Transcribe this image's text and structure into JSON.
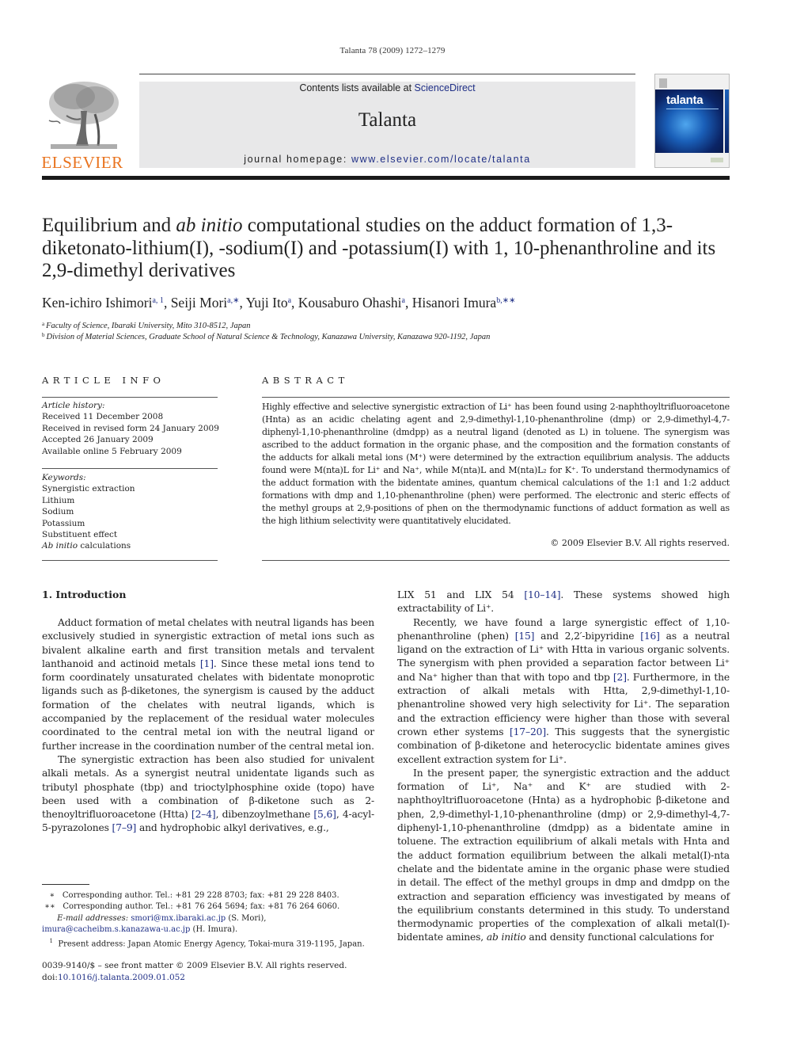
{
  "citation": "Talanta 78 (2009) 1272–1279",
  "masthead": {
    "contents_prefix": "Contents lists available at ",
    "contents_link": "ScienceDirect",
    "journal_title": "Talanta",
    "homepage_prefix": "journal homepage: ",
    "homepage_link": "www.elsevier.com/locate/talanta",
    "publisher_logo_text": "ELSEVIER",
    "cover_title": "talanta",
    "colors": {
      "publisher_orange": "#e9731e",
      "link_blue": "#1f2f86",
      "masthead_gray": "#e8e8e9"
    }
  },
  "article": {
    "title_part1": "Equilibrium and ",
    "title_italic": "ab initio",
    "title_part2": " computational studies on the adduct formation of 1,3-diketonato-lithium(I), -sodium(I) and -potassium(I) with 1, 10-phenanthroline and its 2,9-dimethyl derivatives",
    "authors": [
      {
        "name": "Ken-ichiro Ishimori",
        "marks": "a, 1"
      },
      {
        "name": "Seiji Mori",
        "marks": "a,∗"
      },
      {
        "name": "Yuji Ito",
        "marks": "a"
      },
      {
        "name": "Kousaburo Ohashi",
        "marks": "a"
      },
      {
        "name": "Hisanori Imura",
        "marks": "b,∗∗"
      }
    ],
    "affiliations": [
      {
        "mark": "a",
        "text": "Faculty of Science, Ibaraki University, Mito 310-8512, Japan"
      },
      {
        "mark": "b",
        "text": "Division of Material Sciences, Graduate School of Natural Science & Technology, Kanazawa University, Kanazawa 920-1192, Japan"
      }
    ]
  },
  "article_info": {
    "label": "ARTICLE INFO",
    "history_head": "Article history:",
    "history": [
      "Received 11 December 2008",
      "Received in revised form 24 January 2009",
      "Accepted 26 January 2009",
      "Available online 5 February 2009"
    ],
    "keywords_head": "Keywords:",
    "keywords": [
      "Synergistic extraction",
      "Lithium",
      "Sodium",
      "Potassium",
      "Substituent effect"
    ],
    "keyword_last_italic": "Ab initio",
    "keyword_last_rest": " calculations"
  },
  "abstract": {
    "label": "ABSTRACT",
    "text": "Highly effective and selective synergistic extraction of Li⁺ has been found using 2-naphthoyltrifluoroacetone (Hnta) as an acidic chelating agent and 2,9-dimethyl-1,10-phenanthroline (dmp) or 2,9-dimethyl-4,7-diphenyl-1,10-phenanthroline (dmdpp) as a neutral ligand (denoted as L) in toluene. The synergism was ascribed to the adduct formation in the organic phase, and the composition and the formation constants of the adducts for alkali metal ions (M⁺) were determined by the extraction equilibrium analysis. The adducts found were M(nta)L for Li⁺ and Na⁺, while M(nta)L and M(nta)L₂ for K⁺. To understand thermodynamics of the adduct formation with the bidentate amines, quantum chemical calculations of the 1:1 and 1:2 adduct formations with dmp and 1,10-phenanthroline (phen) were performed. The electronic and steric effects of the methyl groups at 2,9-positions of phen on the thermodynamic functions of adduct formation as well as the high lithium selectivity were quantitatively elucidated.",
    "copyright": "© 2009 Elsevier B.V. All rights reserved."
  },
  "introduction": {
    "heading": "1.  Introduction",
    "left_p1": [
      {
        "t": "Adduct formation of metal chelates with neutral ligands has been exclusively studied in synergistic extraction of metal ions such as bivalent alkaline earth and first transition metals and tervalent lanthanoid and actinoid metals "
      },
      {
        "ref": "[1]"
      },
      {
        "t": ". Since these metal ions tend to form coordinately unsaturated chelates with bidentate monoprotic ligands such as β-diketones, the synergism is caused by the adduct formation of the chelates with neutral ligands, which is accompanied by the replacement of the residual water molecules coordinated to the central metal ion with the neutral ligand or further increase in the coordination number of the central metal ion."
      }
    ],
    "left_p2": [
      {
        "t": "The synergistic extraction has been also studied for univalent alkali metals. As a synergist neutral unidentate ligands such as tributyl phosphate (tbp) and trioctylphosphine oxide (topo) have been used with a combination of β-diketone such as 2-thenoyltrifluoroacetone (Htta) "
      },
      {
        "ref": "[2–4]"
      },
      {
        "t": ", dibenzoylmethane "
      },
      {
        "ref": "[5,6]"
      },
      {
        "t": ", 4-acyl-5-pyrazolones "
      },
      {
        "ref": "[7–9]"
      },
      {
        "t": " and hydrophobic alkyl derivatives, e.g.,"
      }
    ],
    "right_p0": [
      {
        "t": "LIX 51 and LIX 54 "
      },
      {
        "ref": "[10–14]"
      },
      {
        "t": ". These systems showed high extractability of Li⁺."
      }
    ],
    "right_p1": [
      {
        "t": "Recently, we have found a large synergistic effect of 1,10-phenanthroline (phen) "
      },
      {
        "ref": "[15]"
      },
      {
        "t": " and 2,2′-bipyridine "
      },
      {
        "ref": "[16]"
      },
      {
        "t": " as a neutral ligand on the extraction of Li⁺ with Htta in various organic solvents. The synergism with phen provided a separation factor between Li⁺ and Na⁺ higher than that with topo and tbp "
      },
      {
        "ref": "[2]"
      },
      {
        "t": ". Furthermore, in the extraction of alkali metals with Htta, 2,9-dimethyl-1,10-phenantroline showed very high selectivity for Li⁺. The separation and the extraction efficiency were higher than those with several crown ether systems "
      },
      {
        "ref": "[17–20]"
      },
      {
        "t": ". This suggests that the synergistic combination of β-diketone and heterocyclic bidentate amines gives excellent extraction system for Li⁺."
      }
    ],
    "right_p2": [
      {
        "t": "In the present paper, the synergistic extraction and the adduct formation of Li⁺, Na⁺ and K⁺ are studied with 2-naphthoyltrifluoroacetone (Hnta) as a hydrophobic β-diketone and phen, 2,9-dimethyl-1,10-phenanthroline (dmp) or 2,9-dimethyl-4,7-diphenyl-1,10-phenanthroline (dmdpp) as a bidentate amine in toluene. The extraction equilibrium of alkali metals with Hnta and the adduct formation equilibrium between the alkali metal(I)-nta chelate and the bidentate amine in the organic phase were studied in detail. The effect of the methyl groups in dmp and dmdpp on the extraction and separation efficiency was investigated by means of the equilibrium constants determined in this study. To understand thermodynamic properties of the complexation of alkali metal(I)-bidentate amines, "
      },
      {
        "i": "ab initio"
      },
      {
        "t": " and density functional calculations for"
      }
    ]
  },
  "footnotes": {
    "fn1_mark": "∗",
    "fn1_text": "Corresponding author. Tel.: +81 29 228 8703; fax: +81 29 228 8403.",
    "fn2_mark": "∗∗",
    "fn2_text": "Corresponding author. Tel.: +81 76 264 5694; fax: +81 76 264 6060.",
    "email_label": "E-mail addresses:",
    "email1": "smori@mx.ibaraki.ac.jp",
    "email1_owner": " (S. Mori),",
    "email2": "imura@cacheibm.s.kanazawa-u.ac.jp",
    "email2_owner": " (H. Imura).",
    "fn3_mark": "1",
    "fn3_text": "Present address: Japan Atomic Energy Agency, Tokai-mura 319-1195, Japan."
  },
  "front_matter": {
    "issn_line": "0039-9140/$ – see front matter © 2009 Elsevier B.V. All rights reserved.",
    "doi_prefix": "doi:",
    "doi": "10.1016/j.talanta.2009.01.052"
  }
}
